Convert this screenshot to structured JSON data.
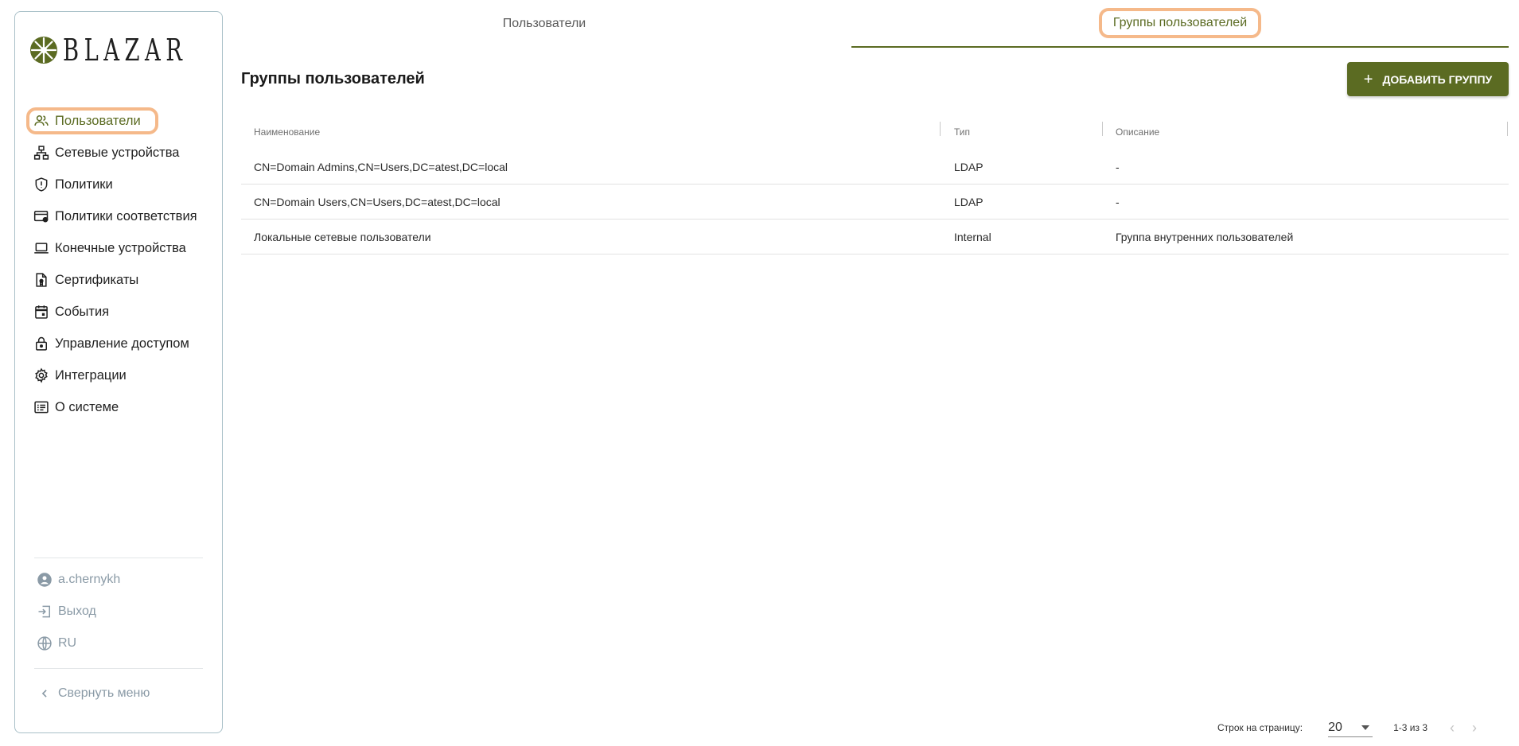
{
  "brand": {
    "name": "BLAZAR",
    "accent": "#5b6b22"
  },
  "sidebar": {
    "items": [
      {
        "label": "Пользователи",
        "icon": "users-icon"
      },
      {
        "label": "Сетевые устройства",
        "icon": "network-icon"
      },
      {
        "label": "Политики",
        "icon": "shield-alert-icon"
      },
      {
        "label": "Политики соответствия",
        "icon": "card-check-icon"
      },
      {
        "label": "Конечные устройства",
        "icon": "laptop-icon"
      },
      {
        "label": "Сертификаты",
        "icon": "certificate-icon"
      },
      {
        "label": "События",
        "icon": "calendar-icon"
      },
      {
        "label": "Управление доступом",
        "icon": "lock-icon"
      },
      {
        "label": "Интеграции",
        "icon": "gear-icon"
      },
      {
        "label": "О системе",
        "icon": "info-list-icon"
      }
    ],
    "user": "a.chernykh",
    "logout": "Выход",
    "language": "RU",
    "collapse": "Свернуть меню"
  },
  "tabs": [
    {
      "label": "Пользователи"
    },
    {
      "label": "Группы пользователей"
    }
  ],
  "page": {
    "title": "Группы пользователей",
    "add_button": "ДОБАВИТЬ ГРУППУ"
  },
  "table": {
    "columns": [
      "Наименование",
      "Тип",
      "Описание"
    ],
    "rows": [
      [
        "CN=Domain Admins,CN=Users,DC=atest,DC=local",
        "LDAP",
        "-"
      ],
      [
        "CN=Domain Users,CN=Users,DC=atest,DC=local",
        "LDAP",
        "-"
      ],
      [
        "Локальные сетевые пользователи",
        "Internal",
        "Группа внутренних пользователей"
      ]
    ]
  },
  "pagination": {
    "rows_label": "Строк на страницу:",
    "rows_per_page": "20",
    "range": "1-3 из 3"
  }
}
